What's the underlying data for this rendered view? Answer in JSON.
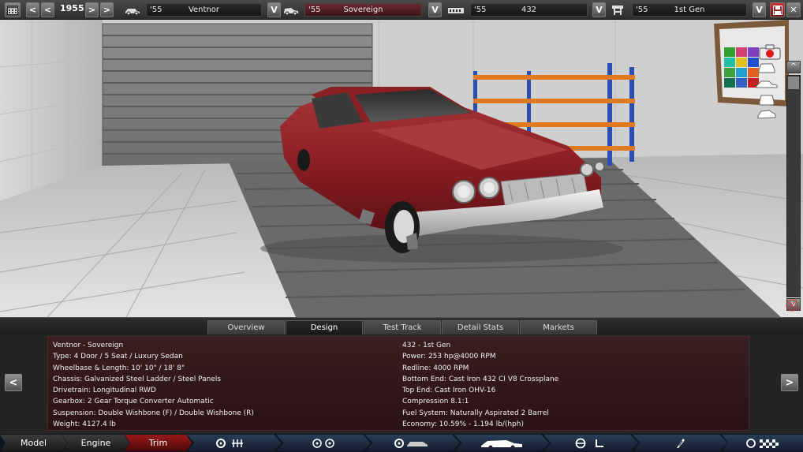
{
  "topbar": {
    "year": "1955",
    "prev_label": "<",
    "prev2_label": "<",
    "next_label": ">",
    "next2_label": ">",
    "dropdown_label": "V",
    "model": {
      "year": "'55",
      "name": "Ventnor"
    },
    "trim": {
      "year": "'55",
      "name": "Sovereign"
    },
    "engine": {
      "year": "'55",
      "name": "432"
    },
    "engine_variant": {
      "year": "'55",
      "name": "1st Gen"
    },
    "close_label": "✕"
  },
  "tabs": [
    {
      "label": "Overview"
    },
    {
      "label": "Design"
    },
    {
      "label": "Test Track"
    },
    {
      "label": "Detail Stats"
    },
    {
      "label": "Markets"
    }
  ],
  "info": {
    "left": [
      "Ventnor - Sovereign",
      "Type: 4 Door / 5 Seat / Luxury Sedan",
      "Wheelbase & Length: 10' 10\" / 18' 8\"",
      "Chassis: Galvanized Steel Ladder / Steel Panels",
      "Drivetrain: Longitudinal RWD",
      "Gearbox: 2 Gear Torque Converter Automatic",
      "Suspension: Double Wishbone (F) / Double Wishbone (R)",
      "Weight: 4127.4 lb"
    ],
    "right": [
      "432 - 1st Gen",
      "Power: 253 hp@4000 RPM",
      "Redline: 4000 RPM",
      "Bottom End: Cast Iron 432 CI V8 Crossplane",
      "Top End: Cast Iron OHV-16",
      "Compression 8.1:1",
      "Fuel System: Naturally Aspirated 2 Barrel",
      "Economy: 10.59% - 1.194 lb/(hph)"
    ],
    "left_arrow": "<",
    "right_arrow": ">"
  },
  "bottom_nav": [
    {
      "label": "Model"
    },
    {
      "label": "Engine"
    },
    {
      "label": "Trim"
    }
  ],
  "scrollbar": {
    "up_label": "^",
    "down_label": "v"
  },
  "colors": {
    "accent_red": "#8a1a1a",
    "car_red": "#8c1f24",
    "shelf_blue": "#2a4fb0",
    "shelf_orange": "#e07a20"
  }
}
